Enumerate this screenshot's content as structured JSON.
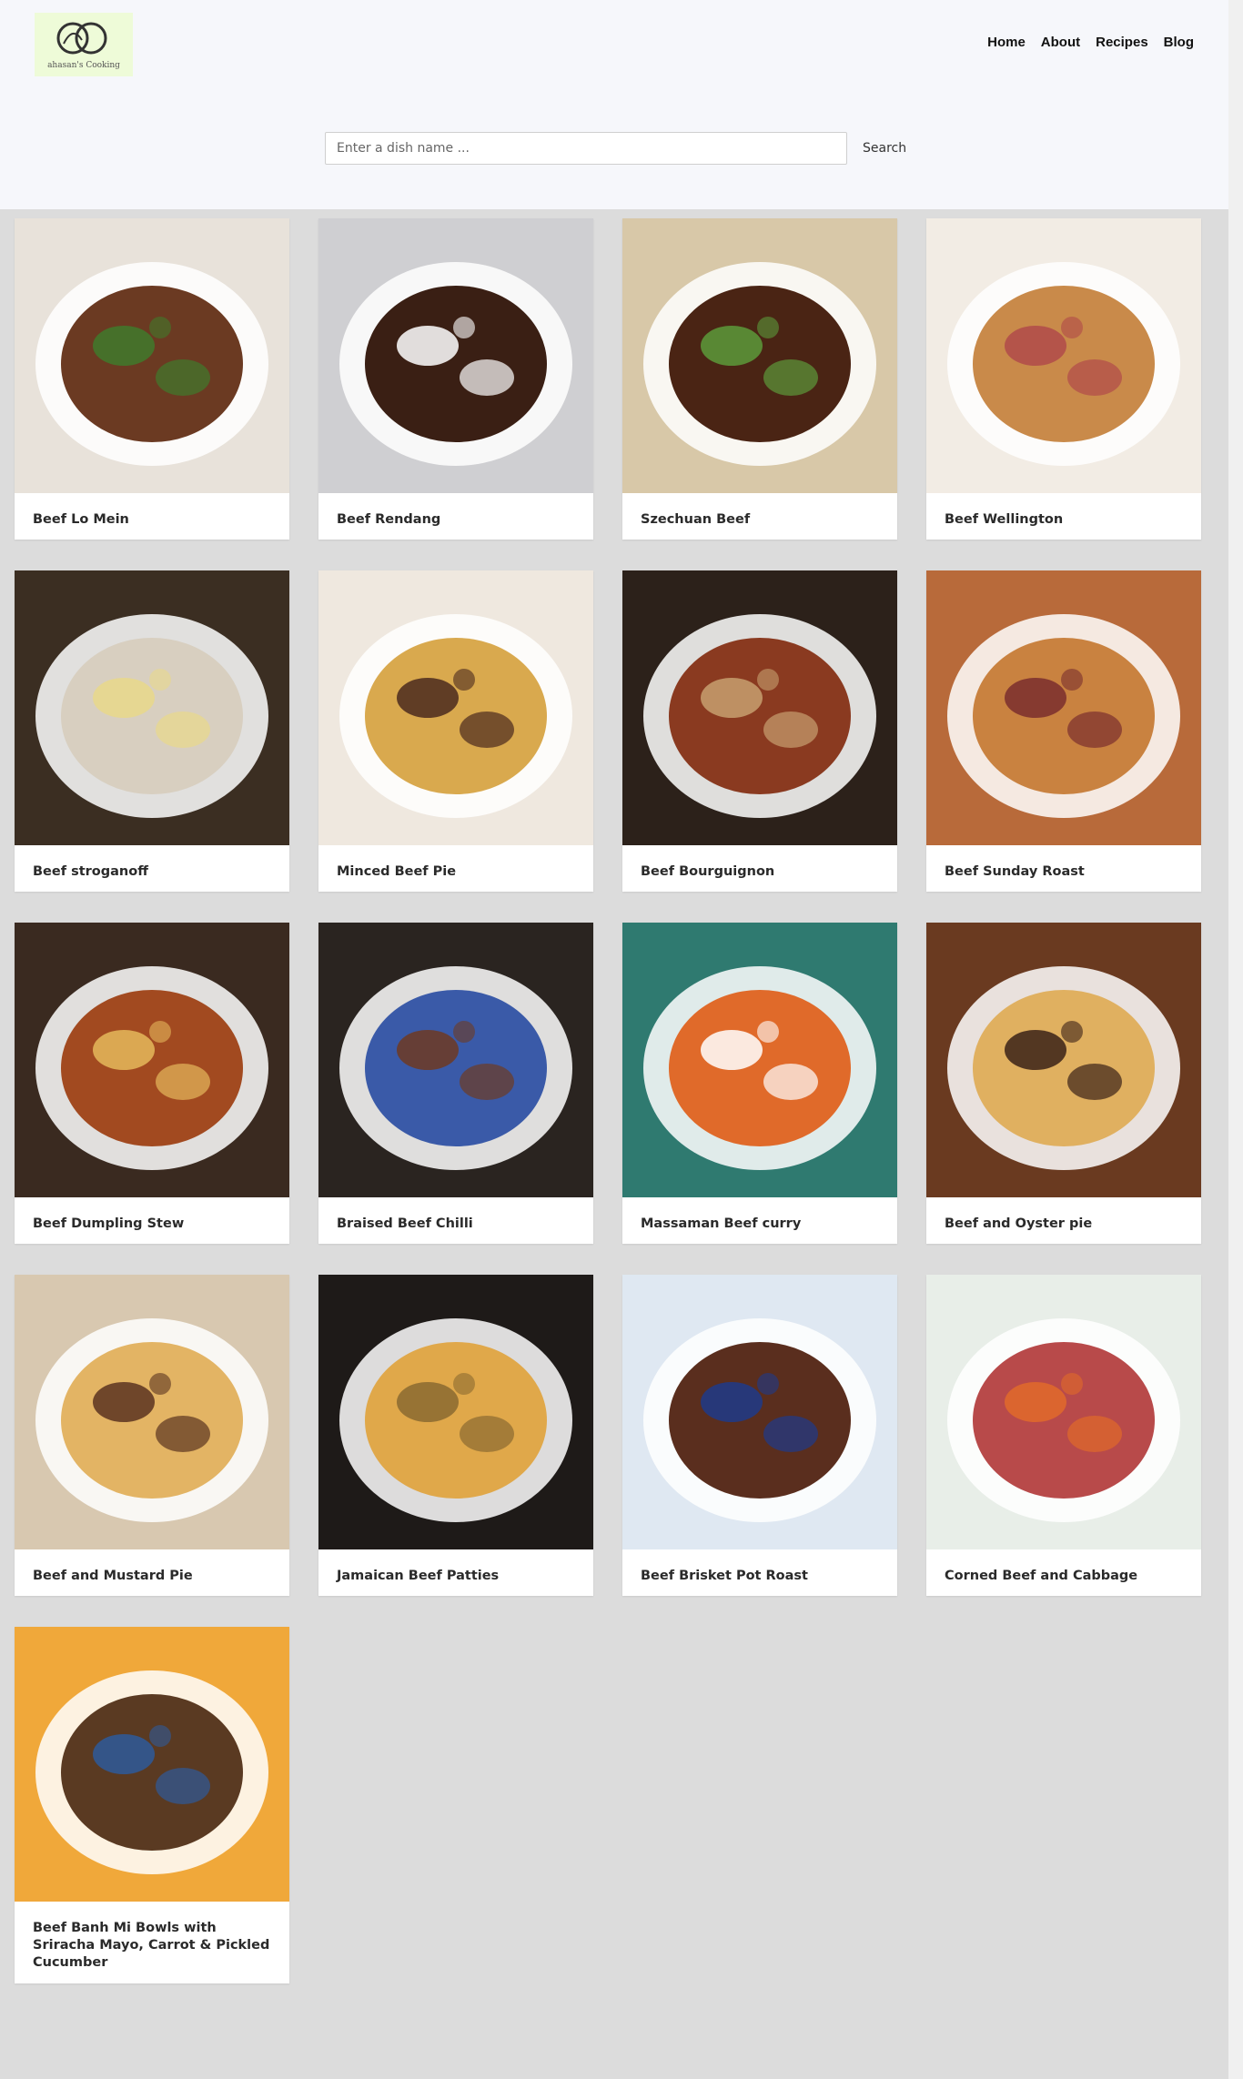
{
  "logo": {
    "text": "ahasan's Cooking"
  },
  "nav": [
    "Home",
    "About",
    "Recipes",
    "Blog"
  ],
  "search": {
    "placeholder": "Enter a dish name ...",
    "value": "",
    "button_label": "Search"
  },
  "recipes": [
    {
      "name": "Beef Lo Mein"
    },
    {
      "name": "Beef Rendang"
    },
    {
      "name": "Szechuan Beef"
    },
    {
      "name": "Beef Wellington"
    },
    {
      "name": "Beef stroganoff"
    },
    {
      "name": "Minced Beef Pie"
    },
    {
      "name": "Beef Bourguignon"
    },
    {
      "name": "Beef Sunday Roast"
    },
    {
      "name": "Beef Dumpling Stew"
    },
    {
      "name": "Braised Beef Chilli"
    },
    {
      "name": "Massaman Beef curry"
    },
    {
      "name": "Beef and Oyster pie"
    },
    {
      "name": "Beef and Mustard Pie"
    },
    {
      "name": "Jamaican Beef Patties"
    },
    {
      "name": "Beef Brisket Pot Roast"
    },
    {
      "name": "Corned Beef and Cabbage"
    },
    {
      "name": "Beef Banh Mi Bowls with Sriracha Mayo, Carrot & Pickled Cucumber"
    }
  ]
}
